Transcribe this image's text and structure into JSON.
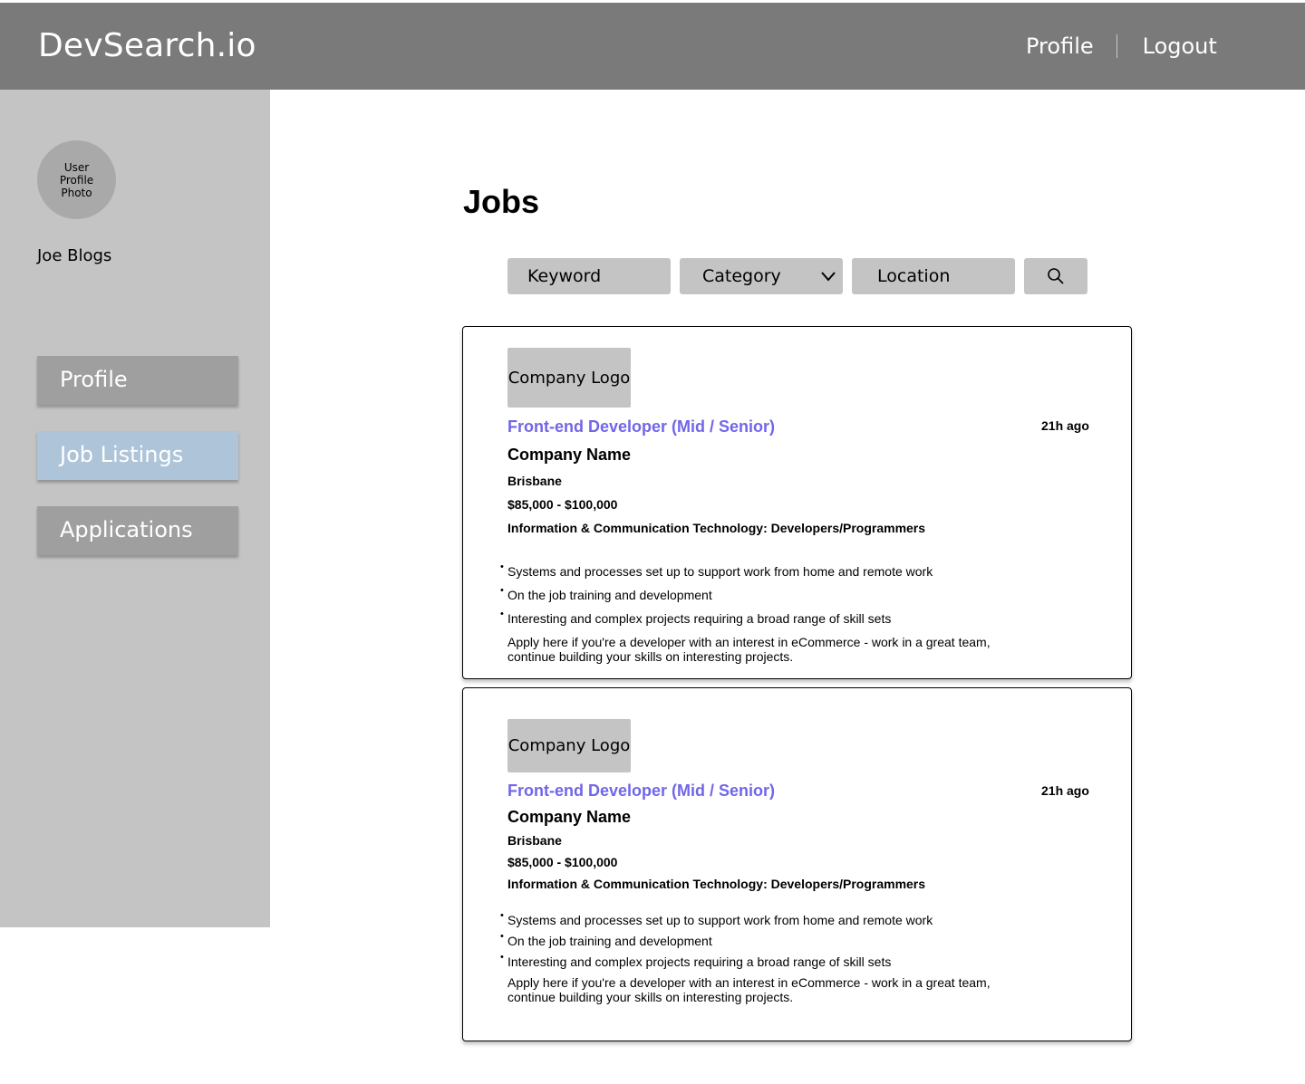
{
  "header": {
    "brand": "DevSearch.io",
    "nav": [
      "Profile",
      "Logout"
    ]
  },
  "sidebar": {
    "avatar_text": "User Profile Photo",
    "username": "Joe Blogs",
    "items": [
      {
        "label": "Profile",
        "active": false
      },
      {
        "label": "Job Listings",
        "active": true
      },
      {
        "label": "Applications",
        "active": false
      }
    ]
  },
  "main": {
    "title": "Jobs",
    "filters": {
      "keyword": "Keyword",
      "category": "Category",
      "location": "Location"
    },
    "jobs": [
      {
        "logo": "Company Logo",
        "title": "Front-end Developer (Mid / Senior)",
        "posted": "21h ago",
        "company": "Company Name",
        "location": "Brisbane",
        "salary": "$85,000 - $100,000",
        "category": "Information & Communication Technology: Developers/Programmers",
        "bullets": [
          "Systems and processes set up to support work from home and remote work",
          "On the job training and development",
          "Interesting and complex projects requiring a broad range of skill sets"
        ],
        "description": "Apply here if you're a developer with an interest in eCommerce - work in a great team, continue building your skills on interesting projects."
      },
      {
        "logo": "Company Logo",
        "title": "Front-end Developer (Mid / Senior)",
        "posted": "21h ago",
        "company": "Company Name",
        "location": "Brisbane",
        "salary": "$85,000 - $100,000",
        "category": "Information & Communication Technology: Developers/Programmers",
        "bullets": [
          "Systems and processes set up to support work from home and remote work",
          "On the job training and development",
          "Interesting and complex projects requiring a broad range of skill sets"
        ],
        "description": "Apply here if you're a developer with an interest in eCommerce - work in a great team, continue building your skills on interesting projects."
      }
    ]
  },
  "colors": {
    "header_bg": "#7a7a7a",
    "sidebar_bg": "#c4c4c4",
    "active_nav": "#aec4d8",
    "job_title": "#7166e8"
  },
  "icons": {
    "search": "search-icon",
    "dropdown": "chevron-down-icon"
  }
}
